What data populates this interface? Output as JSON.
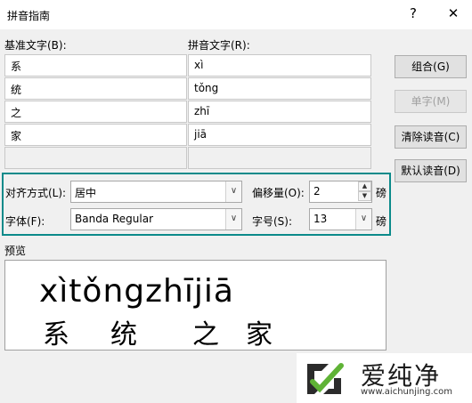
{
  "window": {
    "title": "拼音指南",
    "help": "?",
    "close": "✕"
  },
  "base_label": "基准文字(B):",
  "ruby_label": "拼音文字(R):",
  "rows": [
    {
      "base": "系",
      "ruby": "xì"
    },
    {
      "base": "统",
      "ruby": "tǒng"
    },
    {
      "base": "之",
      "ruby": "zhī"
    },
    {
      "base": "家",
      "ruby": "jiā"
    },
    {
      "base": "",
      "ruby": ""
    }
  ],
  "buttons": {
    "group": "组合(G)",
    "mono": "单字(M)",
    "clear": "清除读音(C)",
    "default": "默认读音(D)"
  },
  "alignment": {
    "label": "对齐方式(L):",
    "value": "居中"
  },
  "offset": {
    "label": "偏移量(O):",
    "value": "2",
    "unit": "磅"
  },
  "font": {
    "label": "字体(F):",
    "value": "Banda Regular"
  },
  "size": {
    "label": "字号(S):",
    "value": "13",
    "unit": "磅"
  },
  "preview": {
    "label": "预览",
    "pinyin": "xìtǒngzhījiā",
    "hanzi": [
      "系",
      "统",
      "之",
      "家"
    ]
  },
  "watermark": {
    "title": "爱纯净",
    "url": "www.aichunjing.com"
  },
  "colors": {
    "highlight": "#0b8a8a",
    "watermark_green": "#5fb336"
  }
}
